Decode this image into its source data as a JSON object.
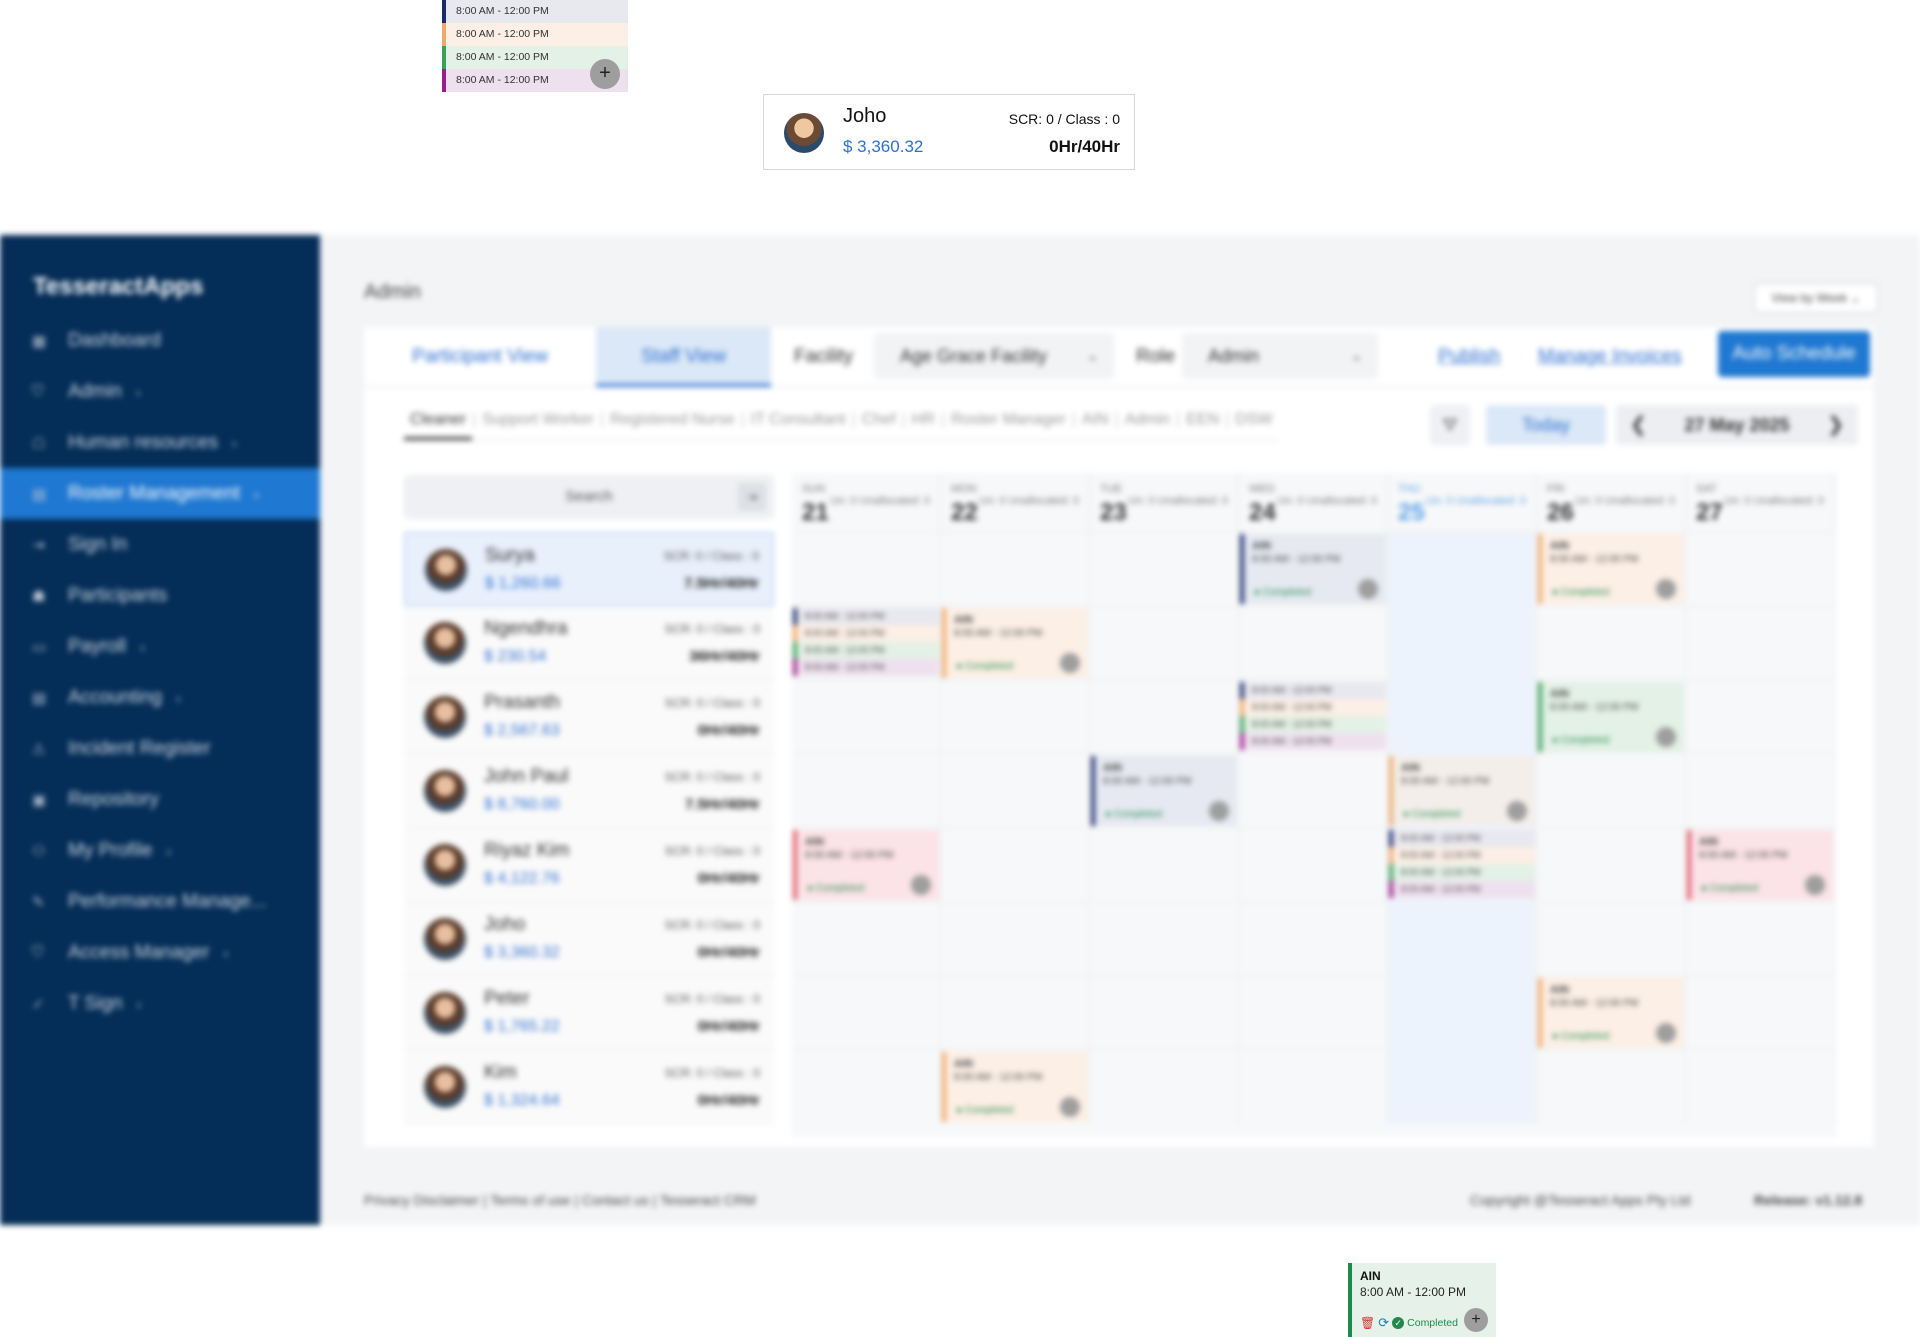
{
  "colors": {
    "sidebar": "#042d57",
    "accent": "#1f78d1",
    "link": "#2f6fd0",
    "completed": "#1f8a4c",
    "shift_navy": "#1b2a6b",
    "shift_orange": "#f0a868",
    "shift_green": "#3aa05a",
    "shift_magenta": "#9c1c8c",
    "shift_red": "#e05a6a"
  },
  "callout_shifts": {
    "items": [
      {
        "time": "8:00 AM - 12:00 PM",
        "bar": "#1b2a6b",
        "bg": "#e8e8ef"
      },
      {
        "time": "8:00 AM - 12:00 PM",
        "bar": "#f0a868",
        "bg": "#fcefe5"
      },
      {
        "time": "8:00 AM - 12:00 PM",
        "bar": "#3aa05a",
        "bg": "#e3f1e6"
      },
      {
        "time": "8:00 AM - 12:00 PM",
        "bar": "#9c1c8c",
        "bg": "#efe0ef"
      }
    ],
    "plus": "+"
  },
  "callout_staff": {
    "name": "Joho",
    "cost": "$ 3,360.32",
    "scr": "SCR: 0 / Class : 0",
    "hours": "0Hr/40Hr"
  },
  "callout_card": {
    "role": "AIN",
    "time": "8:00 AM - 12:00 PM",
    "status": "Completed",
    "plus": "+"
  },
  "sidebar": {
    "brand": "TesseractApps",
    "items": [
      {
        "label": "Dashboard",
        "icon": "grid-icon",
        "glyph": "▦",
        "chev": ""
      },
      {
        "label": "Admin",
        "icon": "shield-icon",
        "glyph": "⛉",
        "chev": "›"
      },
      {
        "label": "Human resources",
        "icon": "people-icon",
        "glyph": "☖",
        "chev": "›"
      },
      {
        "label": "Roster Management",
        "icon": "calendar-icon",
        "glyph": "▤",
        "chev": "›",
        "active": true
      },
      {
        "label": "Sign In",
        "icon": "sign-in-icon",
        "glyph": "⇥",
        "chev": ""
      },
      {
        "label": "Participants",
        "icon": "participants-icon",
        "glyph": "☗",
        "chev": ""
      },
      {
        "label": "Payroll",
        "icon": "payroll-icon",
        "glyph": "▭",
        "chev": "›"
      },
      {
        "label": "Accounting",
        "icon": "accounting-icon",
        "glyph": "▤",
        "chev": "›"
      },
      {
        "label": "Incident Register",
        "icon": "incident-icon",
        "glyph": "⚠",
        "chev": ""
      },
      {
        "label": "Repository",
        "icon": "repository-icon",
        "glyph": "▣",
        "chev": ""
      },
      {
        "label": "My Profile",
        "icon": "profile-icon",
        "glyph": "⚇",
        "chev": "›"
      },
      {
        "label": "Performance Manage...",
        "icon": "performance-icon",
        "glyph": "✎",
        "chev": ""
      },
      {
        "label": "Access Manager",
        "icon": "access-icon",
        "glyph": "⛉",
        "chev": "›"
      },
      {
        "label": "T Sign",
        "icon": "signature-icon",
        "glyph": "✓",
        "chev": "›"
      }
    ]
  },
  "header": {
    "breadcrumb": "Admin",
    "view_by": "View by Week ⌄"
  },
  "toolbar": {
    "tab_participant": "Participant View",
    "tab_staff": "Staff View",
    "facility_label": "Facility",
    "facility_value": "Age Grace Facility",
    "role_label": "Role",
    "role_value": "Admin",
    "dropdown_glyph": "⌄",
    "publish": "Publish",
    "manage_invoices": "Manage Invoices",
    "auto_schedule": "Auto Schedule"
  },
  "roles": [
    "Cleaner",
    "Support Worker",
    "Registered Nurse",
    "IT Consultant",
    "Chef",
    "HR",
    "Roster Manager",
    "AIN",
    "Admin",
    "EEN",
    "DSW"
  ],
  "datebar": {
    "today": "Today",
    "prev": "❮",
    "next": "❯",
    "current": "27 May 2025",
    "filter": "⛛"
  },
  "search": {
    "label": "Search",
    "go": "⇥"
  },
  "staff": [
    {
      "name": "Surya",
      "amount": "$ 1,260.66",
      "scr": "SCR: 0 / Class : 0",
      "hours": "7.5Hr/40Hr",
      "selected": true
    },
    {
      "name": "Ngendhra",
      "amount": "$ 230.54",
      "scr": "SCR: 0 / Class : 0",
      "hours": "36Hr/40Hr"
    },
    {
      "name": "Prasanth",
      "amount": "$ 2,567.63",
      "scr": "SCR: 0 / Class : 0",
      "hours": "0Hr/40Hr"
    },
    {
      "name": "John Paul",
      "amount": "$ 8,760.00",
      "scr": "SCR: 0 / Class : 0",
      "hours": "7.5Hr/40Hr"
    },
    {
      "name": "Riyaz Kim",
      "amount": "$ 4,122.76",
      "scr": "SCR: 0 / Class : 0",
      "hours": "0Hr/40Hr"
    },
    {
      "name": "Joho",
      "amount": "$ 3,360.32",
      "scr": "SCR: 0 / Class : 0",
      "hours": "0Hr/40Hr"
    },
    {
      "name": "Peter",
      "amount": "$ 1,765.22",
      "scr": "SCR: 0 / Class : 0",
      "hours": "0Hr/40Hr"
    },
    {
      "name": "Kim",
      "amount": "$ 1,324.64",
      "scr": "SCR: 0 / Class : 0",
      "hours": "0Hr/40Hr"
    }
  ],
  "calendar": {
    "days": [
      {
        "dow": "SUN",
        "date": "21",
        "count": "Un: 0 Unallocated: 0"
      },
      {
        "dow": "MON",
        "date": "22",
        "count": "Un: 0 Unallocated: 0"
      },
      {
        "dow": "TUE",
        "date": "23",
        "count": "Un: 0 Unallocated: 0"
      },
      {
        "dow": "WED",
        "date": "24",
        "count": "Un: 0 Unallocated: 0"
      },
      {
        "dow": "THU",
        "date": "25",
        "count": "Un: 0 Unallocated: 0",
        "today": true
      },
      {
        "dow": "FRI",
        "date": "26",
        "count": "Un: 0 Unallocated: 0"
      },
      {
        "dow": "SAT",
        "date": "27",
        "count": "Un: 0 Unallocated: 0"
      }
    ],
    "shift_role": "AIN",
    "shift_time": "8:00 AM - 12:00 PM",
    "shift_status": "● Completed",
    "shifts": [
      {
        "row": 0,
        "day": 3,
        "bar": "#1b2a6b",
        "bg": "#e6e9f2"
      },
      {
        "row": 0,
        "day": 5,
        "bar": "#f0a868",
        "bg": "#fcefe5"
      },
      {
        "row": 1,
        "day": 0,
        "multi": true
      },
      {
        "row": 1,
        "day": 1,
        "bar": "#f0a868",
        "bg": "#fcefe5"
      },
      {
        "row": 2,
        "day": 3,
        "multi": true
      },
      {
        "row": 2,
        "day": 5,
        "bar": "#3aa05a",
        "bg": "#e3f1e6"
      },
      {
        "row": 3,
        "day": 2,
        "bar": "#1b2a6b",
        "bg": "#e6e9f2"
      },
      {
        "row": 3,
        "day": 4,
        "bar": "#f0a868",
        "bg": "#f3eeea"
      },
      {
        "row": 4,
        "day": 0,
        "bar": "#e05a6a",
        "bg": "#fbe3e7"
      },
      {
        "row": 4,
        "day": 4,
        "multi": true
      },
      {
        "row": 4,
        "day": 6,
        "bar": "#e05a6a",
        "bg": "#fbe3e7"
      },
      {
        "row": 6,
        "day": 5,
        "bar": "#f0a868",
        "bg": "#fcefe5"
      },
      {
        "row": 7,
        "day": 1,
        "bar": "#f0a868",
        "bg": "#fcefe5"
      }
    ]
  },
  "footer": {
    "links": "Privacy Disclaimer | Terms of use | Contact us | Tesseract CRM",
    "copyright": "Copyright @Tesseract Apps Pty Ltd",
    "release": "Release: v1.12.8"
  }
}
